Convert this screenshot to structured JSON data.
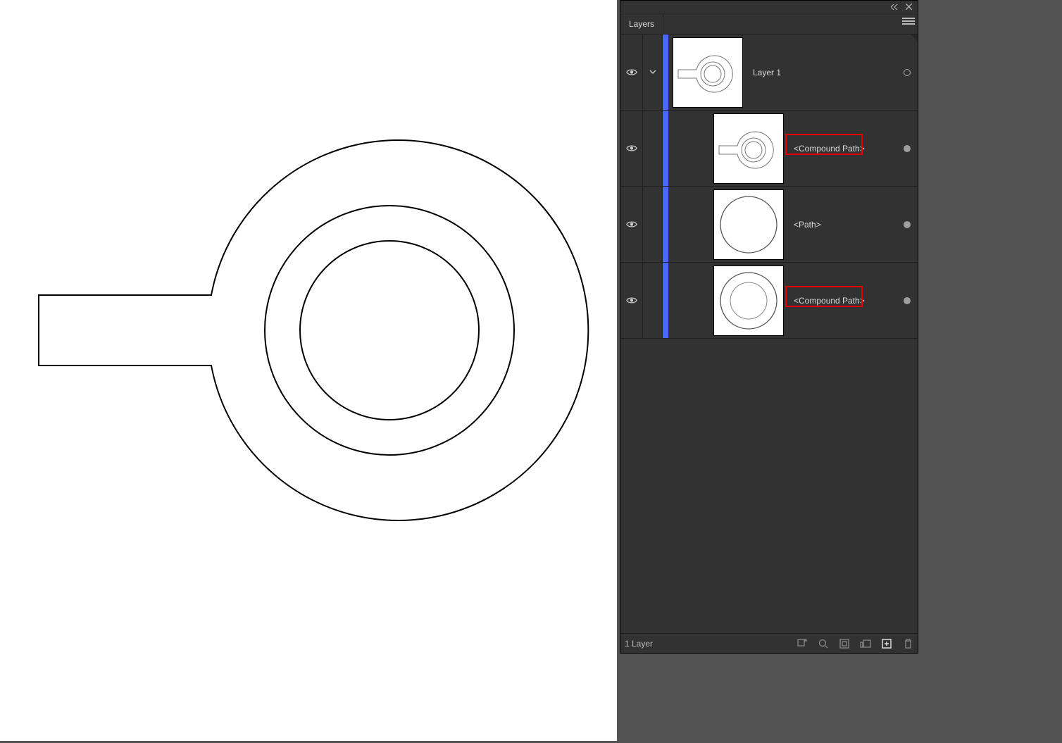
{
  "panel": {
    "tab_label": "Layers",
    "footer_text": "1 Layer"
  },
  "layers": {
    "root": {
      "name": "Layer 1"
    },
    "items": [
      {
        "name": "<Compound Path>",
        "highlighted": true
      },
      {
        "name": "<Path>",
        "highlighted": false
      },
      {
        "name": "<Compound Path>",
        "highlighted": true
      }
    ]
  },
  "colors": {
    "layer_strip": "#4a67ff",
    "highlight": "#e60000"
  }
}
